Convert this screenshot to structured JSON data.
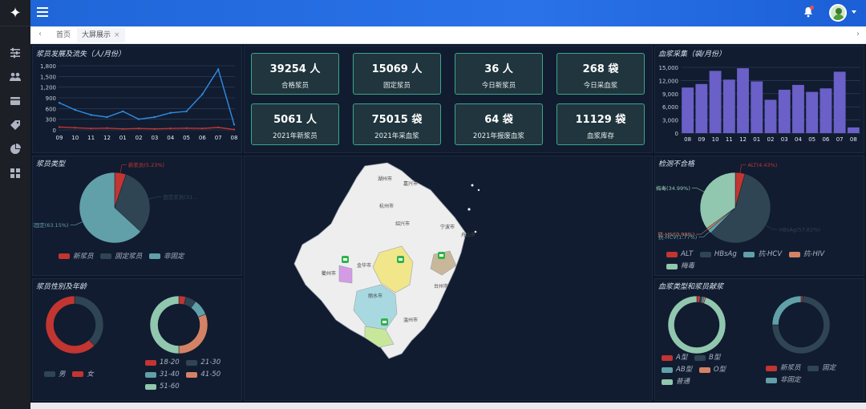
{
  "sidebar": {
    "logo": "✦",
    "icons": [
      "sliders-icon",
      "users-icon",
      "card-icon",
      "tag-icon",
      "pie-icon",
      "grid-icon"
    ]
  },
  "header": {
    "menu_icon": "menu-icon",
    "bell_icon": "bell-icon",
    "avatar": "user-avatar"
  },
  "tabs": {
    "prev": "‹",
    "next": "›",
    "items": [
      {
        "label": "首页"
      },
      {
        "label": "大屏展示",
        "close": "×"
      }
    ]
  },
  "colors": {
    "red": "#c23531",
    "dark": "#2f4554",
    "teal": "#61a0a8",
    "orange": "#d48265",
    "mint": "#91c7ae",
    "blue": "#2f8de4",
    "purple": "#6a60c8",
    "stat_border": "#3ba58e"
  },
  "panels": {
    "donor_trend": {
      "title": "浆员发展及流失（人/月份）",
      "chart_data": {
        "type": "line",
        "categories": [
          "09",
          "10",
          "11",
          "12",
          "01",
          "02",
          "03",
          "04",
          "05",
          "06",
          "07",
          "08"
        ],
        "ylim": [
          0,
          1800
        ],
        "yticks": [
          "1,800",
          "1,500",
          "1,200",
          "900",
          "600",
          "300",
          "0"
        ],
        "series": [
          {
            "values": [
              760,
              560,
              420,
              360,
              520,
              300,
              360,
              480,
              520,
              1000,
              1700,
              150
            ]
          },
          {
            "values": [
              80,
              60,
              40,
              50,
              30,
              40,
              30,
              40,
              50,
              40,
              70,
              10
            ]
          }
        ]
      }
    },
    "stats": [
      {
        "value": "39254 人",
        "label": "合格浆员"
      },
      {
        "value": "15069 人",
        "label": "固定浆员"
      },
      {
        "value": "36 人",
        "label": "今日新浆员"
      },
      {
        "value": "268 袋",
        "label": "今日采血浆"
      },
      {
        "value": "5061 人",
        "label": "2021年新浆员"
      },
      {
        "value": "75015 袋",
        "label": "2021年采血浆"
      },
      {
        "value": "64 袋",
        "label": "2021年报废血浆"
      },
      {
        "value": "11129 袋",
        "label": "血浆库存"
      }
    ],
    "plasma_collect": {
      "title": "血浆采集（袋/月份）",
      "chart_data": {
        "type": "bar",
        "categories": [
          "08",
          "09",
          "10",
          "11",
          "12",
          "01",
          "02",
          "03",
          "04",
          "05",
          "06",
          "07",
          "08"
        ],
        "values": [
          10400,
          11200,
          14200,
          12200,
          14800,
          11800,
          7600,
          9900,
          11000,
          9400,
          10200,
          14000,
          1300
        ],
        "ylim": [
          0,
          15000
        ],
        "yticks": [
          "15,000",
          "12,000",
          "9,000",
          "6,000",
          "3,000",
          "0"
        ]
      }
    },
    "donor_type": {
      "title": "浆员类型",
      "chart_data": {
        "type": "pie",
        "slices": [
          {
            "name": "新浆员",
            "value": 5.23,
            "label": "新浆员(5.23%)"
          },
          {
            "name": "固定浆员",
            "value": 31.62,
            "label": "固定浆员(31..."
          },
          {
            "name": "非固定",
            "value": 63.15,
            "label": "非固定(63.15%)"
          }
        ]
      },
      "legend": [
        "新浆员",
        "固定浆员",
        "非固定"
      ]
    },
    "unqualified": {
      "title": "检测不合格",
      "chart_data": {
        "type": "pie",
        "slices": [
          {
            "name": "ALT",
            "value": 4.43,
            "label": "ALT(4.43%)"
          },
          {
            "name": "HBsAg",
            "value": 57.82,
            "label": "HBsAg(57.82%)"
          },
          {
            "name": "抗-HCV",
            "value": 1.77,
            "label": "抗-HCV(1.77%)"
          },
          {
            "name": "抗-HIV",
            "value": 0.99,
            "label": "抗-HIV(0.99%)"
          },
          {
            "name": "梅毒",
            "value": 34.99,
            "label": "梅毒(34.99%)"
          }
        ]
      },
      "legend": [
        "ALT",
        "HBsAg",
        "抗-HCV",
        "抗-HIV",
        "梅毒"
      ]
    },
    "gender_age": {
      "title": "浆员性别及年龄",
      "chart_data": [
        {
          "type": "pie",
          "slices": [
            {
              "name": "男",
              "value": 38
            },
            {
              "name": "女",
              "value": 62
            }
          ]
        },
        {
          "type": "pie",
          "slices": [
            {
              "name": "18-20",
              "value": 4
            },
            {
              "name": "21-30",
              "value": 6
            },
            {
              "name": "31-40",
              "value": 9
            },
            {
              "name": "41-50",
              "value": 31
            },
            {
              "name": "51-60",
              "value": 50
            }
          ]
        }
      ],
      "legend_gender": [
        "男",
        "女"
      ],
      "legend_age": [
        "18-20",
        "21-30",
        "31-40",
        "41-50",
        "51-60"
      ]
    },
    "blood_type": {
      "title": "血浆类型和浆员献浆",
      "chart_data": [
        {
          "type": "pie",
          "slices": [
            {
              "name": "A型",
              "value": 2
            },
            {
              "name": "B型",
              "value": 1
            },
            {
              "name": "AB型",
              "value": 1
            },
            {
              "name": "O型",
              "value": 1
            },
            {
              "name": "普通",
              "value": 95
            }
          ]
        },
        {
          "type": "pie",
          "slices": [
            {
              "name": "新浆员",
              "value": 1
            },
            {
              "name": "固定",
              "value": 74
            },
            {
              "name": "非固定",
              "value": 25
            }
          ]
        }
      ],
      "legend_blood": [
        "A型",
        "B型",
        "AB型",
        "O型",
        "普通"
      ],
      "legend_donate": [
        "新浆员",
        "固定",
        "非固定"
      ]
    },
    "map": {
      "cities": [
        "湖州市",
        "嘉兴市",
        "杭州市",
        "绍兴市",
        "宁波市",
        "舟山市",
        "衢州市",
        "金华市",
        "台州市",
        "丽水市",
        "温州市"
      ]
    }
  }
}
